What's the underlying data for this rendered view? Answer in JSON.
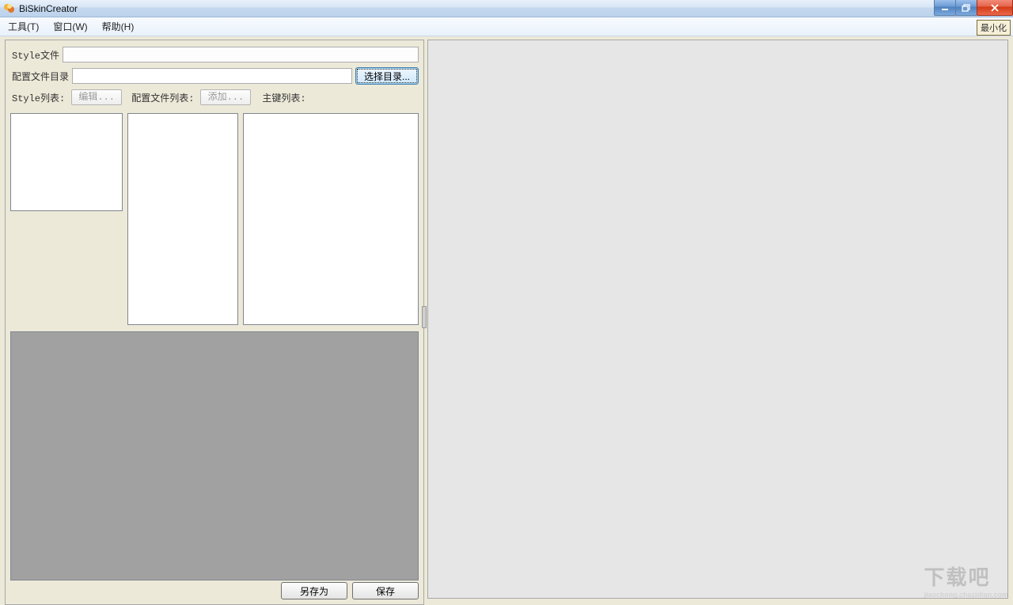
{
  "window": {
    "title": "BiSkinCreator"
  },
  "menu": {
    "tools": "工具(T)",
    "window": "窗口(W)",
    "help": "帮助(H)",
    "minimize_corner": "最小化"
  },
  "form": {
    "style_file_label": "Style文件",
    "style_file_value": "",
    "config_dir_label": "配置文件目录",
    "config_dir_value": "",
    "select_dir_button": "选择目录...",
    "style_list_label": "Style列表:",
    "style_list_btn": "编辑...",
    "config_list_label": "配置文件列表:",
    "config_list_btn": "添加...",
    "key_list_label": "主键列表:"
  },
  "bottom": {
    "save_as": "另存为",
    "save": "保存"
  },
  "watermark": {
    "text": "下载吧",
    "sub": "jiaocheng.chazidian.com"
  }
}
